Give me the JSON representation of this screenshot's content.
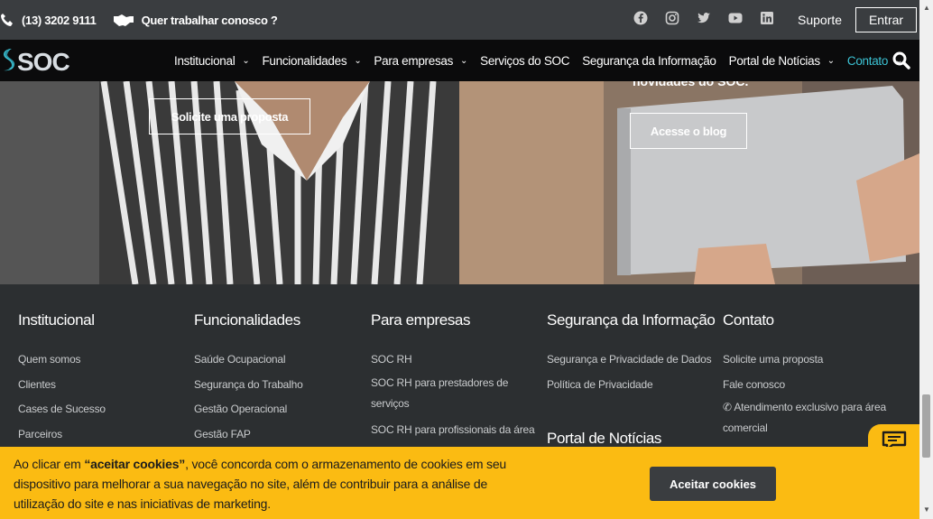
{
  "topbar": {
    "phone": "(13) 3202 9111",
    "careers": "Quer trabalhar conosco ?",
    "social_icons": [
      "facebook-icon",
      "instagram-icon",
      "twitter-icon",
      "youtube-icon",
      "linkedin-icon"
    ],
    "support": "Suporte",
    "login": "Entrar"
  },
  "nav": {
    "logo": "SOC",
    "items": [
      {
        "label": "Institucional",
        "has_dropdown": true
      },
      {
        "label": "Funcionalidades",
        "has_dropdown": true
      },
      {
        "label": "Para empresas",
        "has_dropdown": true
      },
      {
        "label": "Serviços do SOC",
        "has_dropdown": false
      },
      {
        "label": "Segurança da Informação",
        "has_dropdown": false
      },
      {
        "label": "Portal de Notícias",
        "has_dropdown": true
      },
      {
        "label": "Contato",
        "has_dropdown": true
      }
    ],
    "accent_color": "#3cc3d4"
  },
  "hero": {
    "left_button": "Solicite uma proposta",
    "right_text": "novidades do SOC.",
    "right_button": "Acesse o blog"
  },
  "footer": {
    "columns": [
      {
        "title": "Institucional",
        "links": [
          "Quem somos",
          "Clientes",
          "Cases de Sucesso",
          "Parceiros"
        ]
      },
      {
        "title": "Funcionalidades",
        "links": [
          "Saúde Ocupacional",
          "Segurança do Trabalho",
          "Gestão Operacional",
          "Gestão FAP"
        ]
      },
      {
        "title": "Para empresas",
        "links": [
          "SOC RH",
          "SOC RH para prestadores de serviços",
          "SOC RH para profissionais da área"
        ]
      },
      {
        "title": "Segurança da Informação",
        "links": [
          "Segurança e Privacidade de Dados",
          "Política de Privacidade"
        ],
        "second_title": "Portal de Notícias"
      },
      {
        "title": "Contato",
        "links": [
          "Solicite uma proposta",
          "Fale conosco",
          "Atendimento exclusivo para área comercial"
        ]
      }
    ]
  },
  "cookie": {
    "text_prefix": "Ao clicar em ",
    "text_bold": "“aceitar cookies”",
    "text_suffix": ", você concorda com o armazenamento de cookies em seu dispositivo para melhorar a sua navegação no site, além de contribuir para a análise de utilização do site e nas iniciativas de marketing.",
    "button": "Aceitar cookies",
    "background_color": "#fbbb12"
  }
}
